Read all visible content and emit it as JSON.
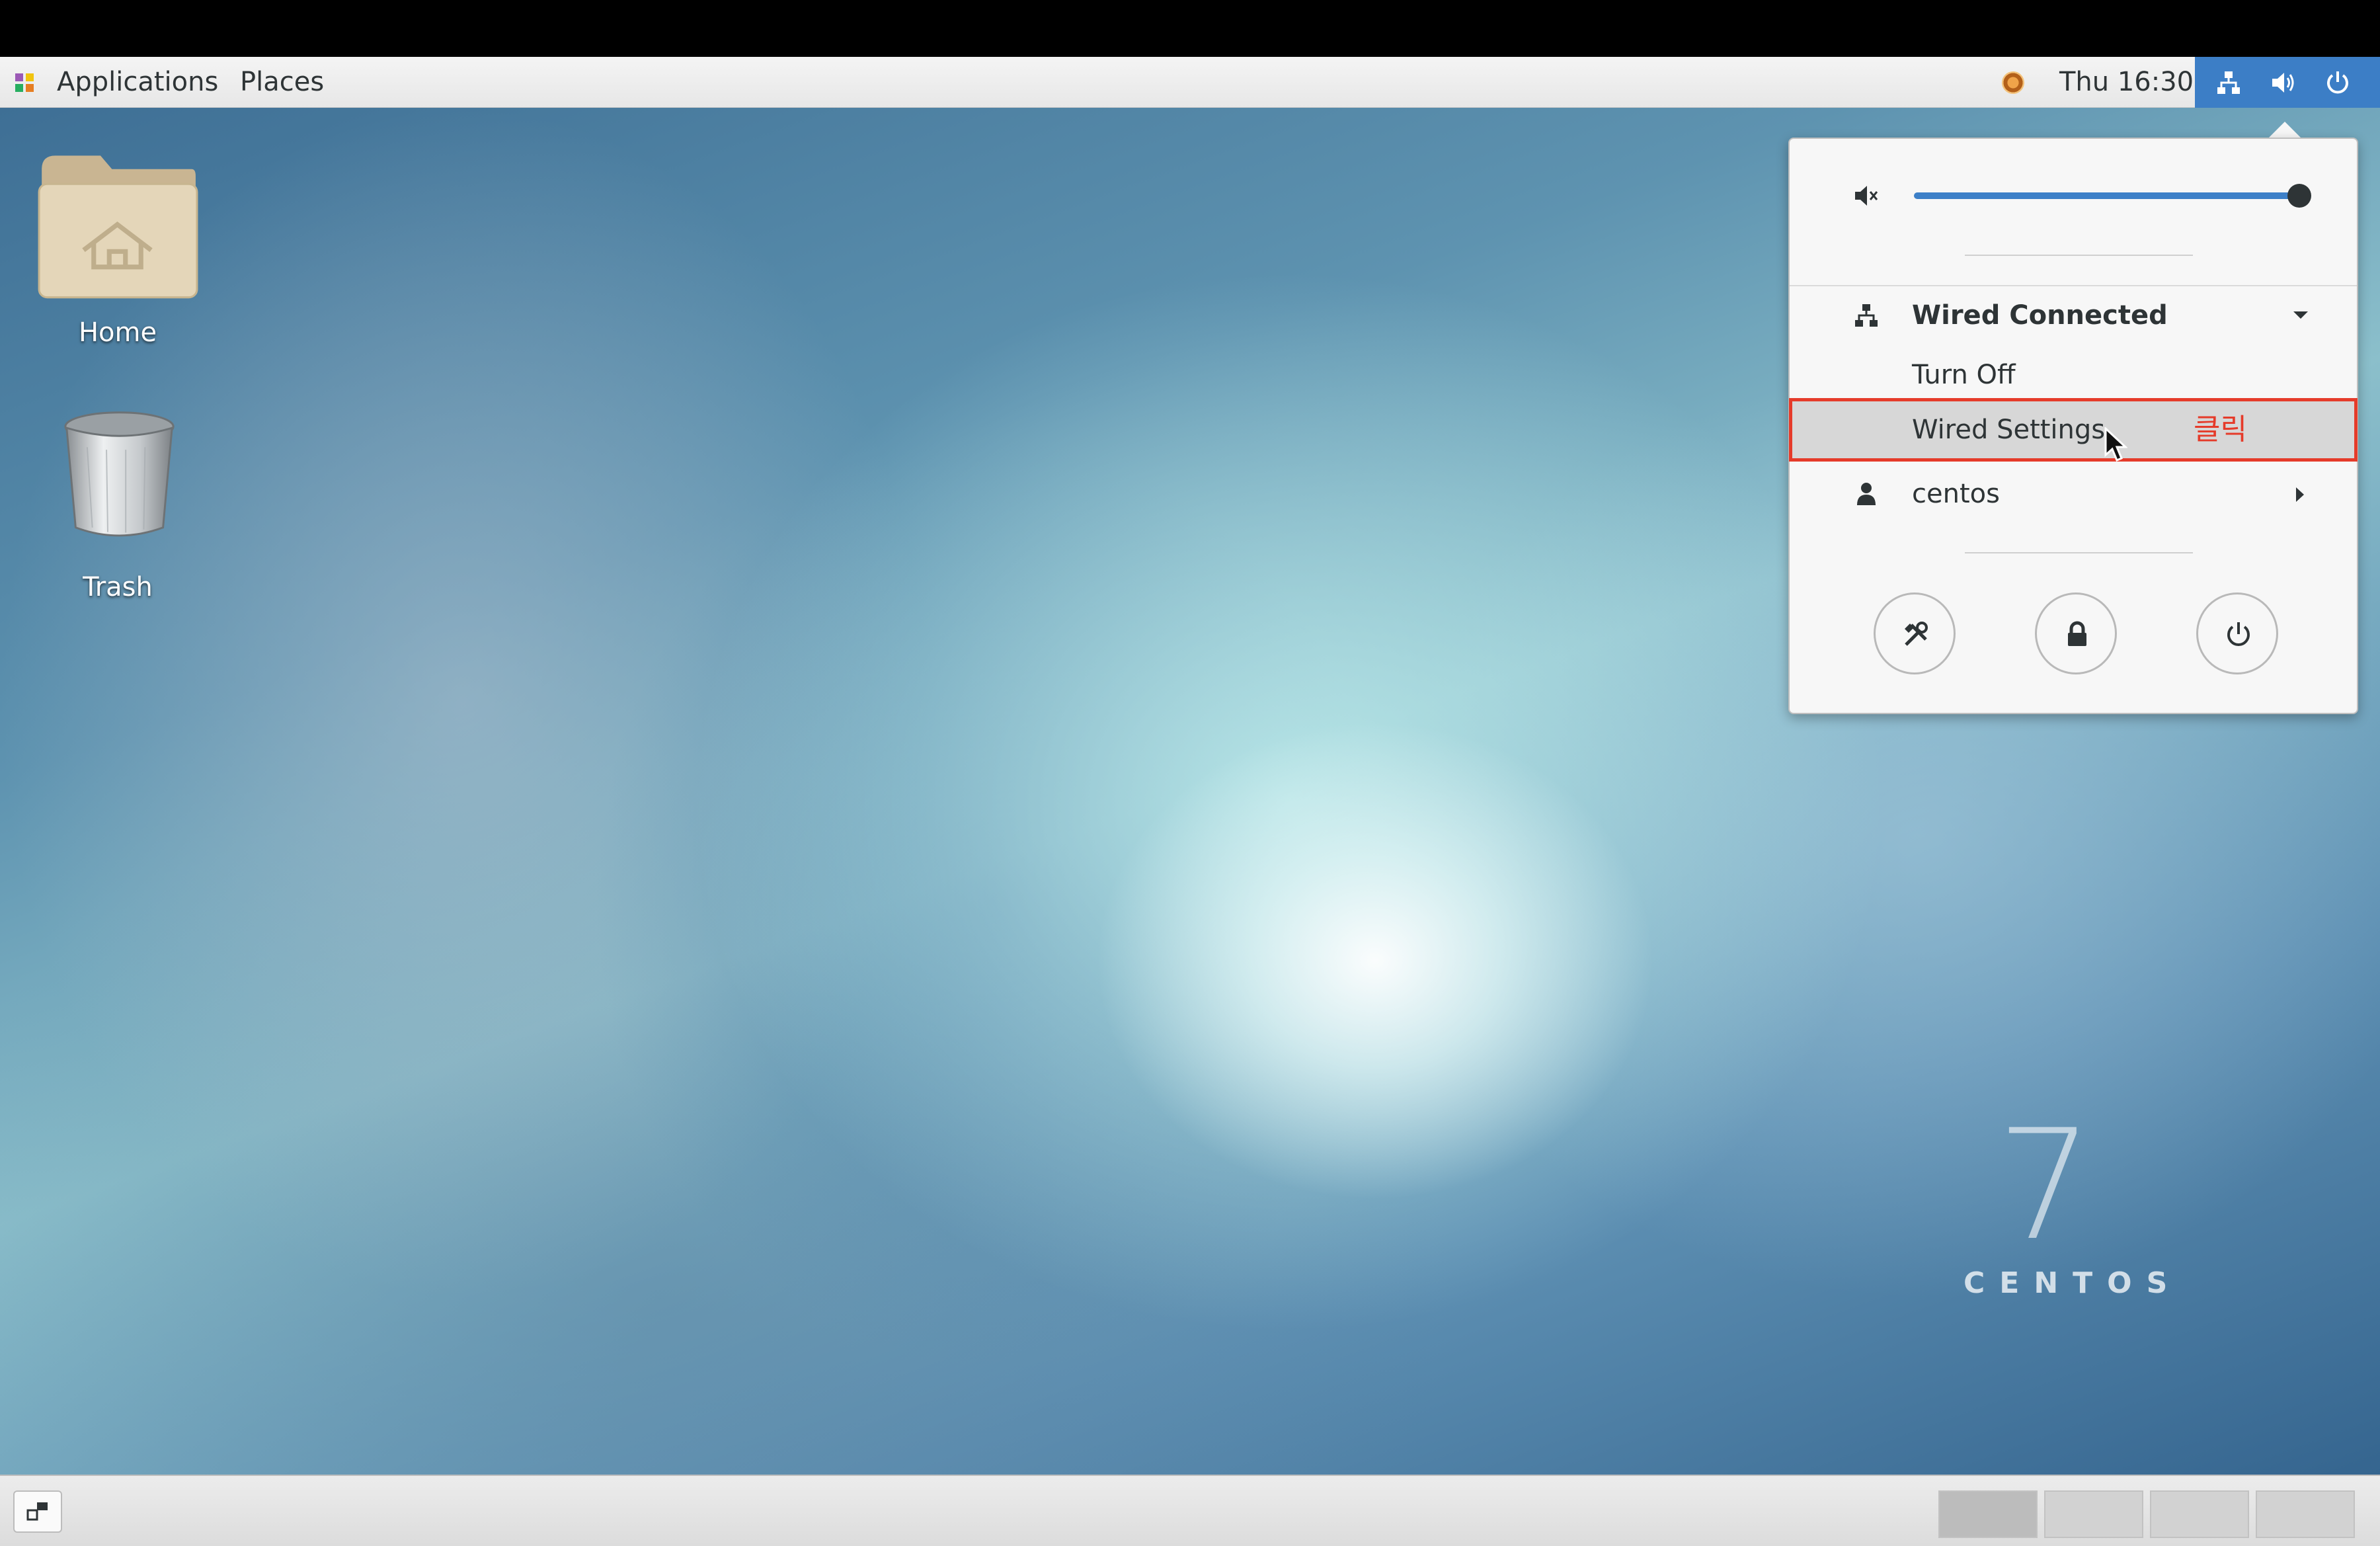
{
  "top_panel": {
    "applications_label": "Applications",
    "places_label": "Places",
    "clock": "Thu 16:30"
  },
  "desktop": {
    "icons": [
      {
        "label": "Home"
      },
      {
        "label": "Trash"
      }
    ],
    "watermark": {
      "number": "7",
      "word": "CENTOS"
    }
  },
  "system_menu": {
    "volume": {
      "level": 1.0
    },
    "network": {
      "title": "Wired Connected",
      "items": [
        {
          "label": "Turn Off"
        },
        {
          "label": "Wired Settings"
        }
      ]
    },
    "user": {
      "label": "centos"
    },
    "annotation": "클릭"
  },
  "colors": {
    "accent": "#3c7ec6",
    "highlight_border": "#e53b2a"
  }
}
